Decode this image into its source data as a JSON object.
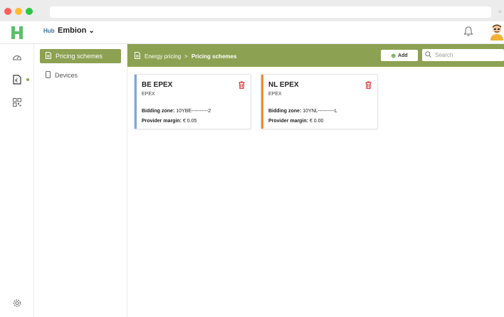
{
  "app": {
    "org_prefix": "Hub",
    "org_name": "Embion",
    "org_chevron": "⌄"
  },
  "colors": {
    "accent": "#8ca152",
    "card1_bar": "#7aa7e0",
    "card2_bar": "#f08a24",
    "delete": "#e03535"
  },
  "subnav": {
    "items": [
      {
        "label": "Pricing schemes",
        "icon": "document-icon",
        "active": true
      },
      {
        "label": "Devices",
        "icon": "device-icon",
        "active": false
      }
    ]
  },
  "toolbar": {
    "breadcrumb": [
      "Energy pricing",
      "Pricing schemes"
    ],
    "separator": ">",
    "add_label": "Add",
    "search_placeholder": "Search"
  },
  "cards": [
    {
      "title": "BE EPEX",
      "subtitle": "EPEX",
      "bidding_label": "Bidding zone:",
      "bidding_value": "10YBE----------2",
      "margin_label": "Provider margin:",
      "margin_value": "€ 0.05"
    },
    {
      "title": "NL EPEX",
      "subtitle": "EPEX",
      "bidding_label": "Bidding zone:",
      "bidding_value": "10YNL----------L",
      "margin_label": "Provider margin:",
      "margin_value": "€ 0.00"
    }
  ]
}
